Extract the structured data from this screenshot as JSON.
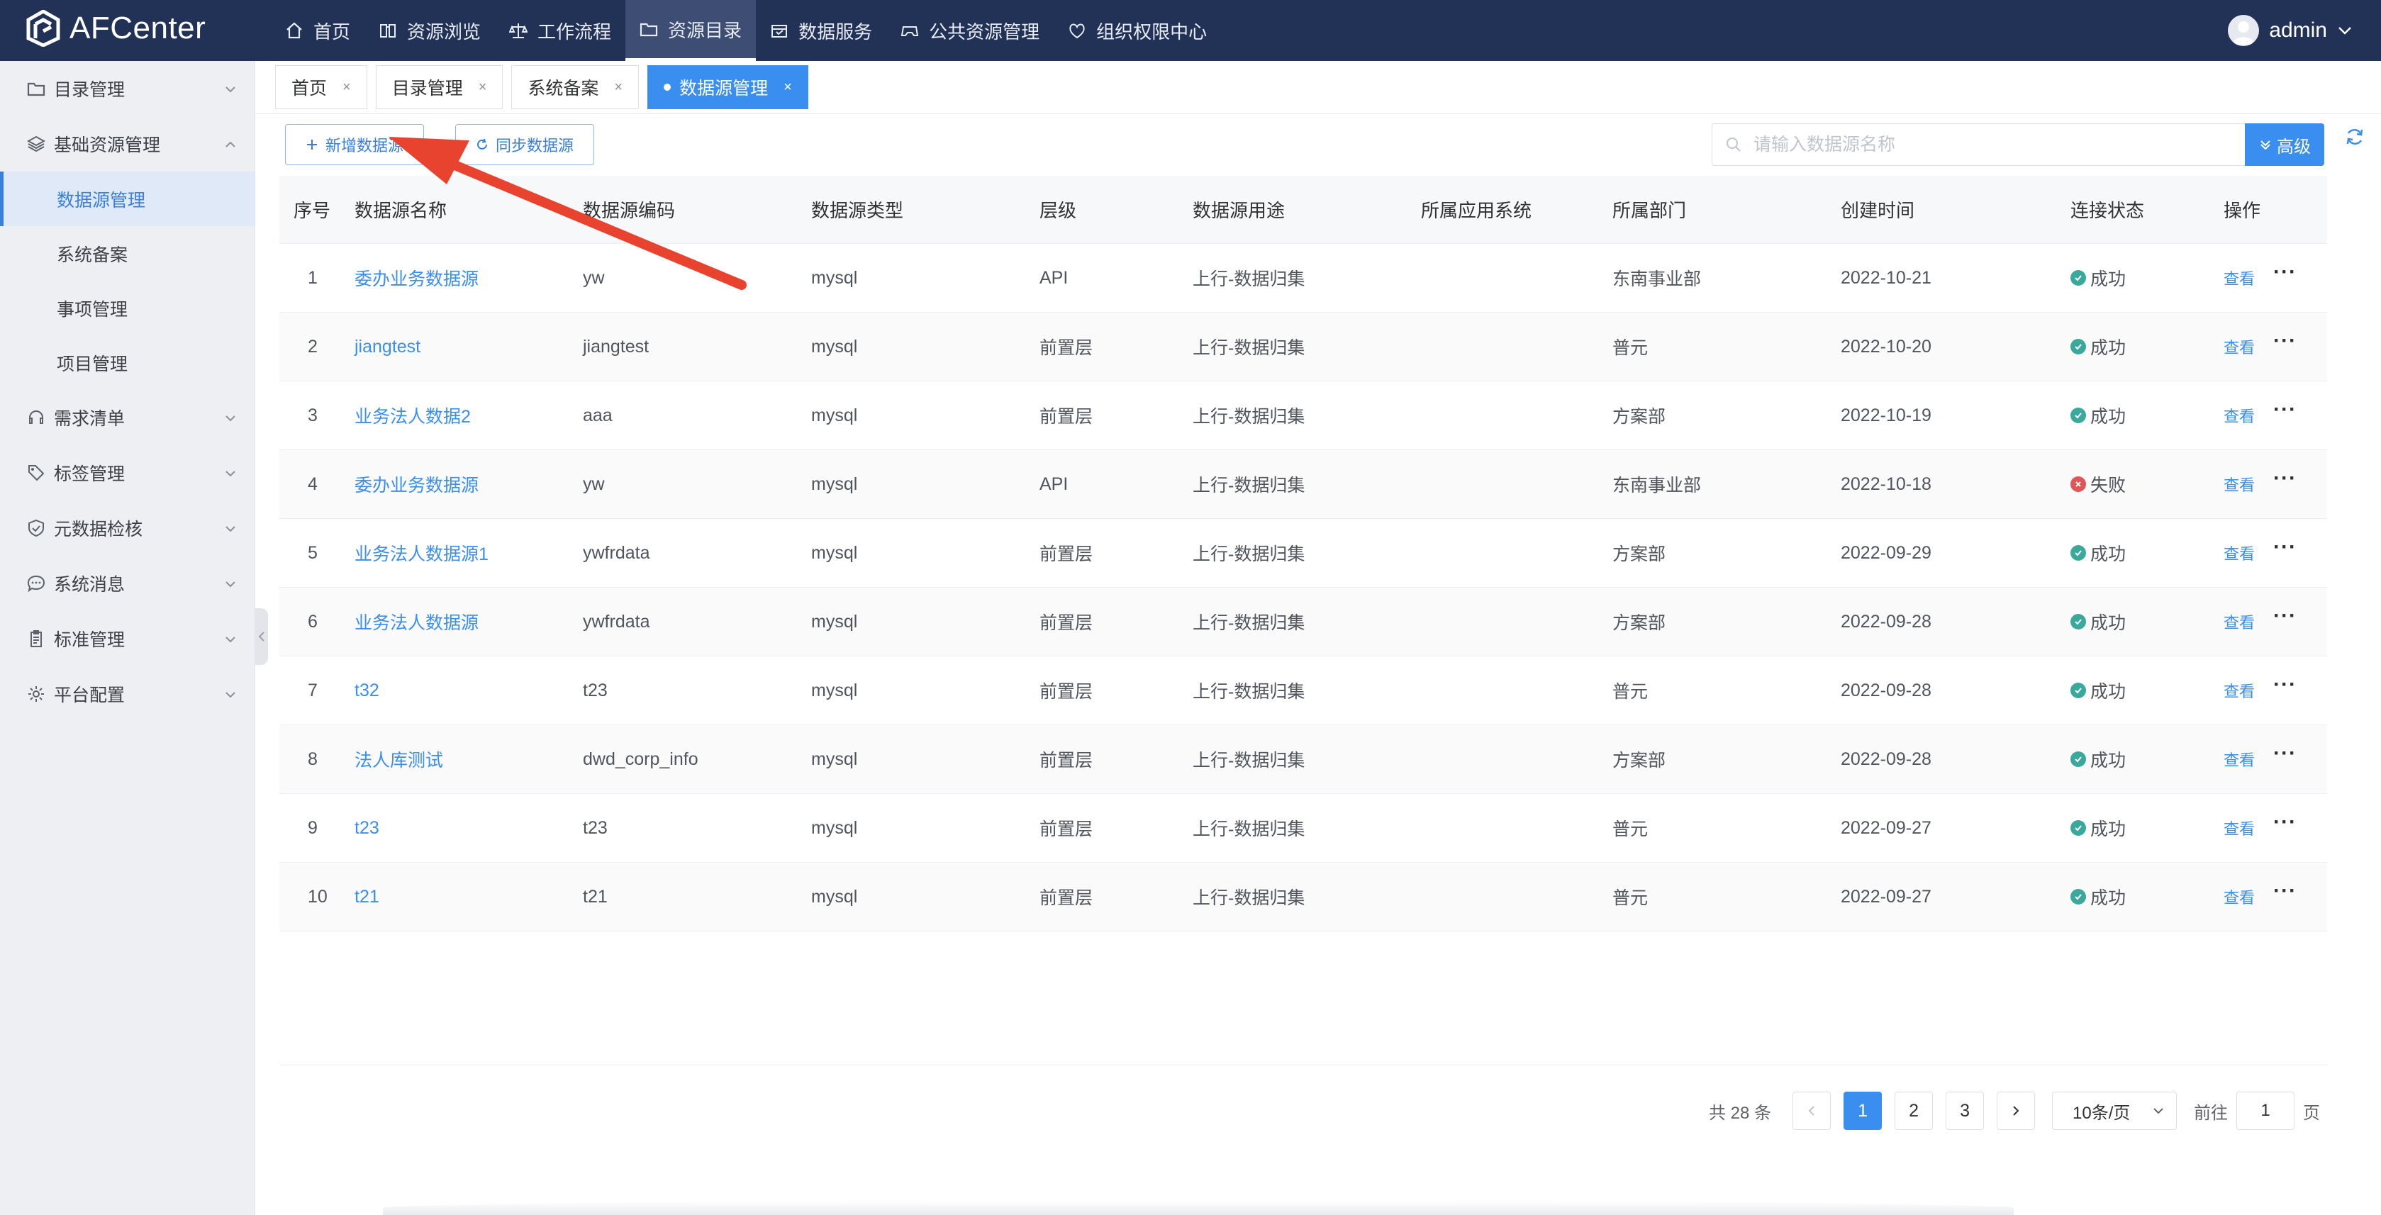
{
  "app": {
    "name": "AFCenter"
  },
  "nav": {
    "items": [
      {
        "label": "首页",
        "icon": "home-icon"
      },
      {
        "label": "资源浏览",
        "icon": "book-icon"
      },
      {
        "label": "工作流程",
        "icon": "scale-icon"
      },
      {
        "label": "资源目录",
        "icon": "folder-icon",
        "active": true
      },
      {
        "label": "数据服务",
        "icon": "service-icon"
      },
      {
        "label": "公共资源管理",
        "icon": "gamepad-icon"
      },
      {
        "label": "组织权限中心",
        "icon": "heart-shield-icon"
      }
    ],
    "user": "admin"
  },
  "sidebar": {
    "groups": [
      {
        "label": "目录管理",
        "icon": "folder-icon",
        "expanded": false
      },
      {
        "label": "基础资源管理",
        "icon": "layers-icon",
        "expanded": true,
        "children": [
          "数据源管理",
          "系统备案",
          "事项管理",
          "项目管理"
        ],
        "active_child": "数据源管理"
      },
      {
        "label": "需求清单",
        "icon": "headset-icon",
        "expanded": false
      },
      {
        "label": "标签管理",
        "icon": "tag-icon",
        "expanded": false
      },
      {
        "label": "元数据检核",
        "icon": "shield-check-icon",
        "expanded": false
      },
      {
        "label": "系统消息",
        "icon": "chat-icon",
        "expanded": false
      },
      {
        "label": "标准管理",
        "icon": "clipboard-icon",
        "expanded": false
      },
      {
        "label": "平台配置",
        "icon": "gear-icon",
        "expanded": false
      }
    ]
  },
  "tabs": [
    {
      "label": "首页",
      "active": false
    },
    {
      "label": "目录管理",
      "active": false
    },
    {
      "label": "系统备案",
      "active": false
    },
    {
      "label": "数据源管理",
      "active": true
    }
  ],
  "toolbar": {
    "add_label": "新增数据源",
    "sync_label": "同步数据源",
    "search_placeholder": "请输入数据源名称",
    "advanced_label": "高级"
  },
  "table": {
    "headers": [
      "序号",
      "数据源名称",
      "数据源编码",
      "数据源类型",
      "层级",
      "数据源用途",
      "所属应用系统",
      "所属部门",
      "创建时间",
      "连接状态",
      "操作"
    ],
    "view_label": "查看",
    "more_label": "···",
    "rows": [
      {
        "no": "1",
        "name": "委办业务数据源",
        "code": "yw",
        "type": "mysql",
        "level": "API",
        "usage": "上行-数据归集",
        "app": "",
        "dept": "东南事业部",
        "created": "2022-10-21",
        "status": "成功"
      },
      {
        "no": "2",
        "name": "jiangtest",
        "code": "jiangtest",
        "type": "mysql",
        "level": "前置层",
        "usage": "上行-数据归集",
        "app": "",
        "dept": "普元",
        "created": "2022-10-20",
        "status": "成功"
      },
      {
        "no": "3",
        "name": "业务法人数据2",
        "code": "aaa",
        "type": "mysql",
        "level": "前置层",
        "usage": "上行-数据归集",
        "app": "",
        "dept": "方案部",
        "created": "2022-10-19",
        "status": "成功"
      },
      {
        "no": "4",
        "name": "委办业务数据源",
        "code": "yw",
        "type": "mysql",
        "level": "API",
        "usage": "上行-数据归集",
        "app": "",
        "dept": "东南事业部",
        "created": "2022-10-18",
        "status": "失败"
      },
      {
        "no": "5",
        "name": "业务法人数据源1",
        "code": "ywfrdata",
        "type": "mysql",
        "level": "前置层",
        "usage": "上行-数据归集",
        "app": "",
        "dept": "方案部",
        "created": "2022-09-29",
        "status": "成功"
      },
      {
        "no": "6",
        "name": "业务法人数据源",
        "code": "ywfrdata",
        "type": "mysql",
        "level": "前置层",
        "usage": "上行-数据归集",
        "app": "",
        "dept": "方案部",
        "created": "2022-09-28",
        "status": "成功"
      },
      {
        "no": "7",
        "name": "t32",
        "code": "t23",
        "type": "mysql",
        "level": "前置层",
        "usage": "上行-数据归集",
        "app": "",
        "dept": "普元",
        "created": "2022-09-28",
        "status": "成功"
      },
      {
        "no": "8",
        "name": "法人库测试",
        "code": "dwd_corp_info",
        "type": "mysql",
        "level": "前置层",
        "usage": "上行-数据归集",
        "app": "",
        "dept": "方案部",
        "created": "2022-09-28",
        "status": "成功"
      },
      {
        "no": "9",
        "name": "t23",
        "code": "t23",
        "type": "mysql",
        "level": "前置层",
        "usage": "上行-数据归集",
        "app": "",
        "dept": "普元",
        "created": "2022-09-27",
        "status": "成功"
      },
      {
        "no": "10",
        "name": "t21",
        "code": "t21",
        "type": "mysql",
        "level": "前置层",
        "usage": "上行-数据归集",
        "app": "",
        "dept": "普元",
        "created": "2022-09-27",
        "status": "成功"
      }
    ]
  },
  "pagination": {
    "total_text": "共 28 条",
    "pages": [
      "1",
      "2",
      "3"
    ],
    "current": "1",
    "page_size": "10条/页",
    "goto_label": "前往",
    "goto_value": "1",
    "page_suffix": "页"
  },
  "colors": {
    "topbar": "#223156",
    "primary": "#3a8ef0",
    "success": "#3aa89a",
    "failure": "#e05555",
    "annotation_arrow": "#e8432e"
  }
}
